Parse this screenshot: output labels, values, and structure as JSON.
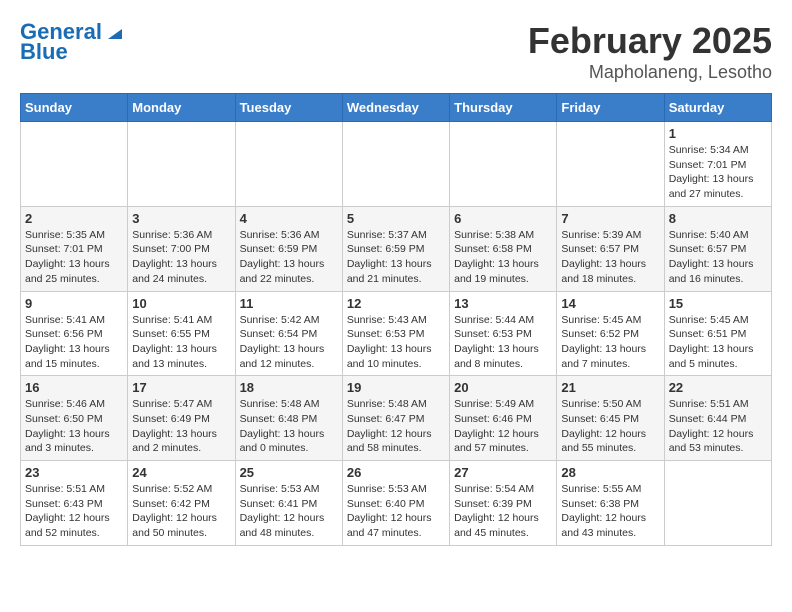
{
  "header": {
    "logo_line1": "General",
    "logo_line2": "Blue",
    "month": "February 2025",
    "location": "Mapholaneng, Lesotho"
  },
  "days_of_week": [
    "Sunday",
    "Monday",
    "Tuesday",
    "Wednesday",
    "Thursday",
    "Friday",
    "Saturday"
  ],
  "weeks": [
    [
      {
        "day": "",
        "info": ""
      },
      {
        "day": "",
        "info": ""
      },
      {
        "day": "",
        "info": ""
      },
      {
        "day": "",
        "info": ""
      },
      {
        "day": "",
        "info": ""
      },
      {
        "day": "",
        "info": ""
      },
      {
        "day": "1",
        "info": "Sunrise: 5:34 AM\nSunset: 7:01 PM\nDaylight: 13 hours\nand 27 minutes."
      }
    ],
    [
      {
        "day": "2",
        "info": "Sunrise: 5:35 AM\nSunset: 7:01 PM\nDaylight: 13 hours\nand 25 minutes."
      },
      {
        "day": "3",
        "info": "Sunrise: 5:36 AM\nSunset: 7:00 PM\nDaylight: 13 hours\nand 24 minutes."
      },
      {
        "day": "4",
        "info": "Sunrise: 5:36 AM\nSunset: 6:59 PM\nDaylight: 13 hours\nand 22 minutes."
      },
      {
        "day": "5",
        "info": "Sunrise: 5:37 AM\nSunset: 6:59 PM\nDaylight: 13 hours\nand 21 minutes."
      },
      {
        "day": "6",
        "info": "Sunrise: 5:38 AM\nSunset: 6:58 PM\nDaylight: 13 hours\nand 19 minutes."
      },
      {
        "day": "7",
        "info": "Sunrise: 5:39 AM\nSunset: 6:57 PM\nDaylight: 13 hours\nand 18 minutes."
      },
      {
        "day": "8",
        "info": "Sunrise: 5:40 AM\nSunset: 6:57 PM\nDaylight: 13 hours\nand 16 minutes."
      }
    ],
    [
      {
        "day": "9",
        "info": "Sunrise: 5:41 AM\nSunset: 6:56 PM\nDaylight: 13 hours\nand 15 minutes."
      },
      {
        "day": "10",
        "info": "Sunrise: 5:41 AM\nSunset: 6:55 PM\nDaylight: 13 hours\nand 13 minutes."
      },
      {
        "day": "11",
        "info": "Sunrise: 5:42 AM\nSunset: 6:54 PM\nDaylight: 13 hours\nand 12 minutes."
      },
      {
        "day": "12",
        "info": "Sunrise: 5:43 AM\nSunset: 6:53 PM\nDaylight: 13 hours\nand 10 minutes."
      },
      {
        "day": "13",
        "info": "Sunrise: 5:44 AM\nSunset: 6:53 PM\nDaylight: 13 hours\nand 8 minutes."
      },
      {
        "day": "14",
        "info": "Sunrise: 5:45 AM\nSunset: 6:52 PM\nDaylight: 13 hours\nand 7 minutes."
      },
      {
        "day": "15",
        "info": "Sunrise: 5:45 AM\nSunset: 6:51 PM\nDaylight: 13 hours\nand 5 minutes."
      }
    ],
    [
      {
        "day": "16",
        "info": "Sunrise: 5:46 AM\nSunset: 6:50 PM\nDaylight: 13 hours\nand 3 minutes."
      },
      {
        "day": "17",
        "info": "Sunrise: 5:47 AM\nSunset: 6:49 PM\nDaylight: 13 hours\nand 2 minutes."
      },
      {
        "day": "18",
        "info": "Sunrise: 5:48 AM\nSunset: 6:48 PM\nDaylight: 13 hours\nand 0 minutes."
      },
      {
        "day": "19",
        "info": "Sunrise: 5:48 AM\nSunset: 6:47 PM\nDaylight: 12 hours\nand 58 minutes."
      },
      {
        "day": "20",
        "info": "Sunrise: 5:49 AM\nSunset: 6:46 PM\nDaylight: 12 hours\nand 57 minutes."
      },
      {
        "day": "21",
        "info": "Sunrise: 5:50 AM\nSunset: 6:45 PM\nDaylight: 12 hours\nand 55 minutes."
      },
      {
        "day": "22",
        "info": "Sunrise: 5:51 AM\nSunset: 6:44 PM\nDaylight: 12 hours\nand 53 minutes."
      }
    ],
    [
      {
        "day": "23",
        "info": "Sunrise: 5:51 AM\nSunset: 6:43 PM\nDaylight: 12 hours\nand 52 minutes."
      },
      {
        "day": "24",
        "info": "Sunrise: 5:52 AM\nSunset: 6:42 PM\nDaylight: 12 hours\nand 50 minutes."
      },
      {
        "day": "25",
        "info": "Sunrise: 5:53 AM\nSunset: 6:41 PM\nDaylight: 12 hours\nand 48 minutes."
      },
      {
        "day": "26",
        "info": "Sunrise: 5:53 AM\nSunset: 6:40 PM\nDaylight: 12 hours\nand 47 minutes."
      },
      {
        "day": "27",
        "info": "Sunrise: 5:54 AM\nSunset: 6:39 PM\nDaylight: 12 hours\nand 45 minutes."
      },
      {
        "day": "28",
        "info": "Sunrise: 5:55 AM\nSunset: 6:38 PM\nDaylight: 12 hours\nand 43 minutes."
      },
      {
        "day": "",
        "info": ""
      }
    ]
  ]
}
